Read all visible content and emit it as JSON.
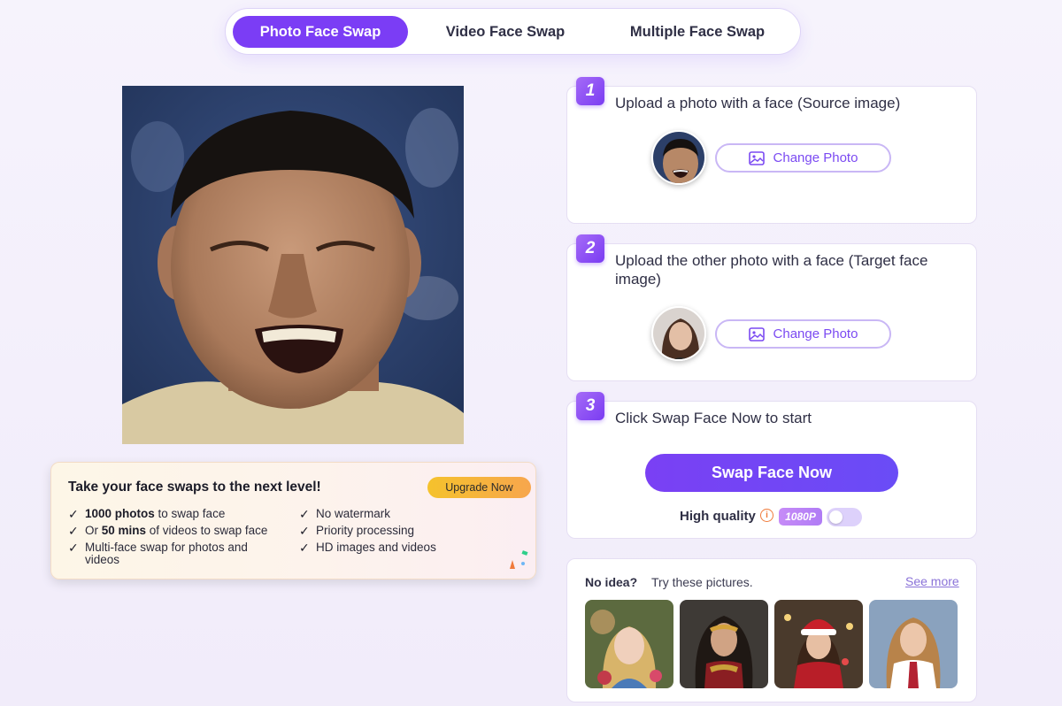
{
  "tabs": [
    {
      "label": "Photo Face Swap",
      "active": true
    },
    {
      "label": "Video Face Swap",
      "active": false
    },
    {
      "label": "Multiple Face Swap",
      "active": false
    }
  ],
  "promo": {
    "title": "Take your face swaps to the next level!",
    "upgrade_label": "Upgrade Now",
    "features_left": [
      {
        "bold": "1000 photos",
        "pre": "",
        "post": " to swap face"
      },
      {
        "bold": "50 mins",
        "pre": "Or ",
        "post": " of videos to swap face"
      },
      {
        "bold": "",
        "pre": "Multi-face swap for photos and videos",
        "post": ""
      }
    ],
    "features_right": [
      "No watermark",
      "Priority processing",
      "HD images and videos"
    ]
  },
  "steps": [
    {
      "number": "1",
      "text": "Upload a photo with a face (Source image)",
      "button": "Change Photo"
    },
    {
      "number": "2",
      "text": "Upload the other photo with a face (Target face image)",
      "button": "Change Photo"
    },
    {
      "number": "3",
      "text": "Click Swap Face Now to start",
      "button": "Swap Face Now"
    }
  ],
  "quality": {
    "label": "High quality",
    "info": "i",
    "badge": "1080P",
    "enabled": false
  },
  "suggestions": {
    "prompt_bold": "No idea?",
    "prompt": "Try these pictures.",
    "see_more": "See more"
  },
  "colors": {
    "accent": "#7b3df5",
    "upgrade": "#f5c22c"
  },
  "icons": [
    "image-icon",
    "check-icon",
    "info-icon"
  ]
}
